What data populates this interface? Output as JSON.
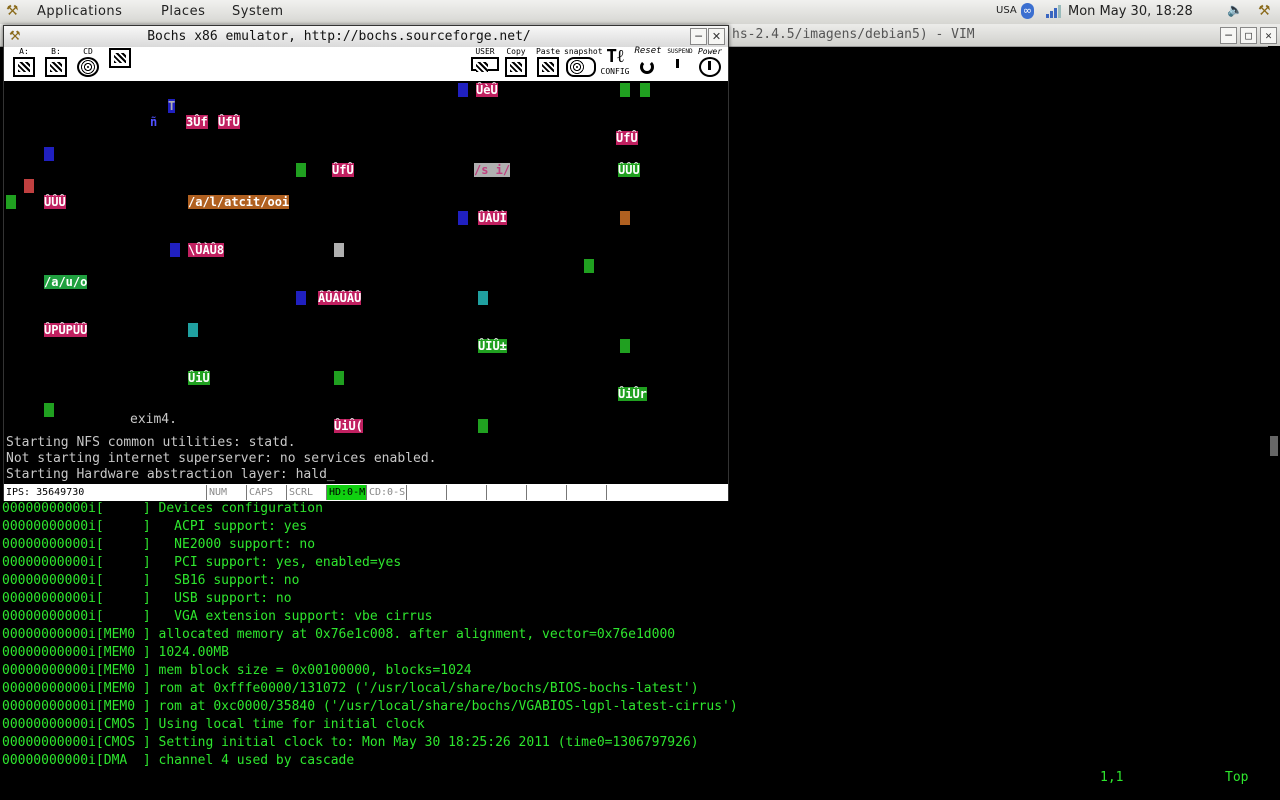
{
  "panel": {
    "menus": [
      "Applications",
      "Places",
      "System"
    ],
    "keyboard_layout": "USA",
    "clock": "Mon May 30, 18:28",
    "icons": [
      "gnome-foot-icon",
      "bluetooth-icon",
      "network-signal-icon",
      "volume-icon",
      "gnome-foot-icon"
    ]
  },
  "vim": {
    "title": "hs-2.4.5/imagens/debian5) - VIM",
    "log_lines": [
      "00000000000i[     ] Devices configuration",
      "00000000000i[     ]   ACPI support: yes",
      "00000000000i[     ]   NE2000 support: no",
      "00000000000i[     ]   PCI support: yes, enabled=yes",
      "00000000000i[     ]   SB16 support: no",
      "00000000000i[     ]   USB support: no",
      "00000000000i[     ]   VGA extension support: vbe cirrus",
      "00000000000i[MEM0 ] allocated memory at 0x76e1c008. after alignment, vector=0x76e1d000",
      "00000000000i[MEM0 ] 1024.00MB",
      "00000000000i[MEM0 ] mem block size = 0x00100000, blocks=1024",
      "00000000000i[MEM0 ] rom at 0xfffe0000/131072 ('/usr/local/share/bochs/BIOS-bochs-latest')",
      "00000000000i[MEM0 ] rom at 0xc0000/35840 ('/usr/local/share/bochs/VGABIOS-lgpl-latest-cirrus')",
      "00000000000i[CMOS ] Using local time for initial clock",
      "00000000000i[CMOS ] Setting initial clock to: Mon May 30 18:25:26 2011 (time0=1306797926)",
      "00000000000i[DMA  ] channel 4 used by cascade"
    ],
    "cursor_pos": "1,1",
    "scroll_pos": "Top"
  },
  "bochs": {
    "title": "Bochs x86 emulator, http://bochs.sourceforge.net/",
    "toolbar_left": [
      {
        "label": "A:",
        "icon": "floppy-a-icon"
      },
      {
        "label": "B:",
        "icon": "floppy-b-icon"
      },
      {
        "label": "CD",
        "icon": "cdrom-icon"
      },
      {
        "label": "",
        "icon": "mouse-icon"
      }
    ],
    "toolbar_right": [
      {
        "label": "USER",
        "icon": "user-keyboard-icon"
      },
      {
        "label": "Copy",
        "icon": "copy-icon"
      },
      {
        "label": "Paste",
        "icon": "paste-icon"
      },
      {
        "label": "snapshot",
        "icon": "snapshot-icon"
      },
      {
        "label": "CONFIG",
        "icon": "config-icon"
      },
      {
        "label": "Reset",
        "icon": "reset-icon"
      },
      {
        "label": "SUSPEND",
        "icon": "suspend-icon"
      },
      {
        "label": "Power",
        "icon": "power-icon"
      }
    ],
    "console_lines": [
      "Starting NFS common utilities: statd.",
      "Not starting internet superserver: no services enabled.",
      "Starting Hardware abstraction layer: hald_"
    ],
    "fragment_exim": "exim4.",
    "garbage": [
      {
        "t": "T",
        "c": "#b0b0b0",
        "b": "#2020c0"
      },
      {
        "t": "3Ûf",
        "c": "#fff",
        "b": "#c02060"
      },
      {
        "t": "ÛfÛ",
        "c": "#fff",
        "b": "#c02060"
      },
      {
        "t": "ñ",
        "c": "#5050ff",
        "b": ""
      },
      {
        "t": "ÛèÛ",
        "c": "#fff",
        "b": "#c02060"
      },
      {
        "t": "ÛfÛ",
        "c": "#fff",
        "b": "#c02060"
      },
      {
        "t": "ÛÛÛ",
        "c": "#fff",
        "b": "#20a020"
      },
      {
        "t": "ÛfÛ",
        "c": "#fff",
        "b": "#c02060"
      },
      {
        "t": "/s i/",
        "c": "#c04080",
        "b": "#b0b0b0"
      },
      {
        "t": "/a/l/atcit/ooi",
        "c": "#fff",
        "b": "#b06020"
      },
      {
        "t": "ÛÀÛÌ",
        "c": "#fff",
        "b": "#c02060"
      },
      {
        "t": "\\ÛÀÛ8",
        "c": "#fff",
        "b": "#c02060"
      },
      {
        "t": "/a/u/o",
        "c": "#fff",
        "b": "#20a040"
      },
      {
        "t": "ÂÛÂÛÂÛ",
        "c": "#fff",
        "b": "#c02060"
      },
      {
        "t": "ÛPÛPÛÛ",
        "c": "#fff",
        "b": "#c02060"
      },
      {
        "t": "ÛÌÛ±",
        "c": "#fff",
        "b": "#20a020"
      },
      {
        "t": "ÛiÛ",
        "c": "#fff",
        "b": "#20a020"
      },
      {
        "t": "ÛiÛr",
        "c": "#fff",
        "b": "#20a020"
      },
      {
        "t": "ÛiÛ(",
        "c": "#fff",
        "b": "#c02060"
      },
      {
        "t": "ÛÛÛ",
        "c": "#fff",
        "b": "#c02060"
      }
    ],
    "status": {
      "ips": "IPS:  35649730",
      "num": "NUM",
      "caps": "CAPS",
      "scrl": "SCRL",
      "hd": "HD:0-M",
      "cd": "CD:0-S"
    }
  }
}
